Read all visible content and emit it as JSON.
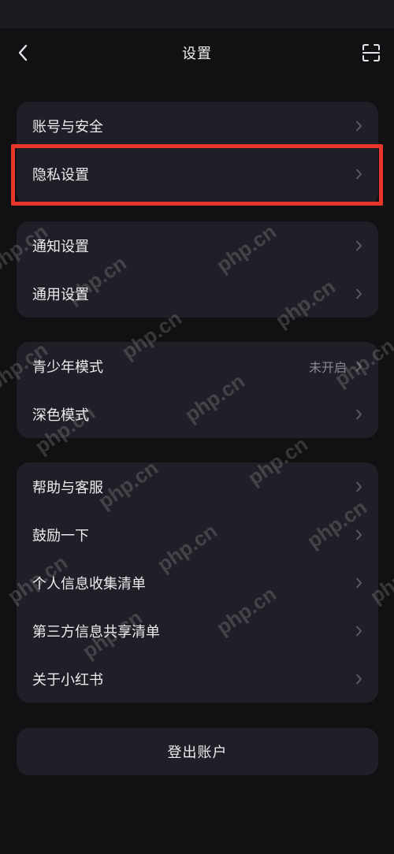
{
  "header": {
    "title": "设置",
    "back_icon": "chevron-left-icon",
    "scan_icon": "scan-icon"
  },
  "groups": [
    {
      "items": [
        {
          "label": "账号与安全"
        },
        {
          "label": "隐私设置",
          "highlighted": true
        }
      ]
    },
    {
      "items": [
        {
          "label": "通知设置"
        },
        {
          "label": "通用设置"
        }
      ]
    },
    {
      "items": [
        {
          "label": "青少年模式",
          "value": "未开启"
        },
        {
          "label": "深色模式"
        }
      ]
    },
    {
      "items": [
        {
          "label": "帮助与客服"
        },
        {
          "label": "鼓励一下"
        },
        {
          "label": "个人信息收集清单"
        },
        {
          "label": "第三方信息共享清单"
        },
        {
          "label": "关于小红书"
        }
      ]
    }
  ],
  "logout": {
    "label": "登出账户"
  },
  "watermark": {
    "text": "php.cn"
  },
  "colors": {
    "background": "#111114",
    "card": "#1f1f27",
    "highlight_border": "#e8372a",
    "secondary_text": "#8b8a92"
  }
}
